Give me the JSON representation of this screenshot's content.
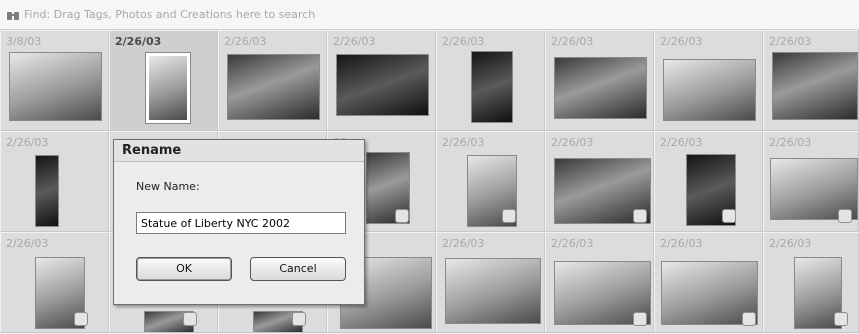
{
  "findbar": {
    "icon": "binoculars-icon",
    "placeholder": "Find: Drag Tags, Photos and Creations here to search"
  },
  "grid": {
    "rows": [
      [
        "3/8/03",
        "2/26/03",
        "2/26/03",
        "2/26/03",
        "2/26/03",
        "2/26/03",
        "2/26/03",
        "2/26/03"
      ],
      [
        "2/26/03",
        "",
        "",
        "03",
        "2/26/03",
        "2/26/03",
        "2/26/03",
        "2/26/03"
      ],
      [
        "2/26/03",
        "",
        "",
        "",
        "2/26/03",
        "2/26/03",
        "2/26/03",
        "2/26/03"
      ]
    ]
  },
  "dialog": {
    "title": "Rename",
    "label": "New Name:",
    "value": "Statue of Liberty NYC 2002",
    "ok_label": "OK",
    "cancel_label": "Cancel"
  }
}
